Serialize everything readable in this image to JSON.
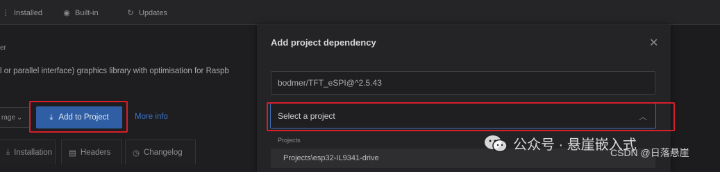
{
  "top_tabs": [
    {
      "label": "Installed",
      "icon": "list-icon"
    },
    {
      "label": "Built-in",
      "icon": "eye-icon"
    },
    {
      "label": "Updates",
      "icon": "refresh-icon"
    }
  ],
  "library": {
    "name_fragment": "er",
    "description_fragment": "l or parallel interface) graphics library with optimisation for Raspb",
    "storage_label": "rage",
    "add_to_project": "Add to Project",
    "more_info": "More info"
  },
  "bottom_tabs": [
    {
      "label": "Installation",
      "icon": "download-icon"
    },
    {
      "label": "Headers",
      "icon": "file-icon"
    },
    {
      "label": "Changelog",
      "icon": "clock-icon"
    }
  ],
  "modal": {
    "title": "Add project dependency",
    "close_icon": "✕",
    "dependency_value": "bodmer/TFT_eSPI@^2.5.43",
    "select_placeholder": "Select a project",
    "dropdown_group": "Projects",
    "dropdown_items": [
      "Projects\\esp32-IL9341-drive"
    ]
  },
  "watermark": {
    "line1": "公众号 · 悬崖嵌入式",
    "line2": "CSDN @日落悬崖"
  },
  "colors": {
    "accent_blue": "#2f5ea4",
    "highlight_red": "#d81e2a"
  }
}
